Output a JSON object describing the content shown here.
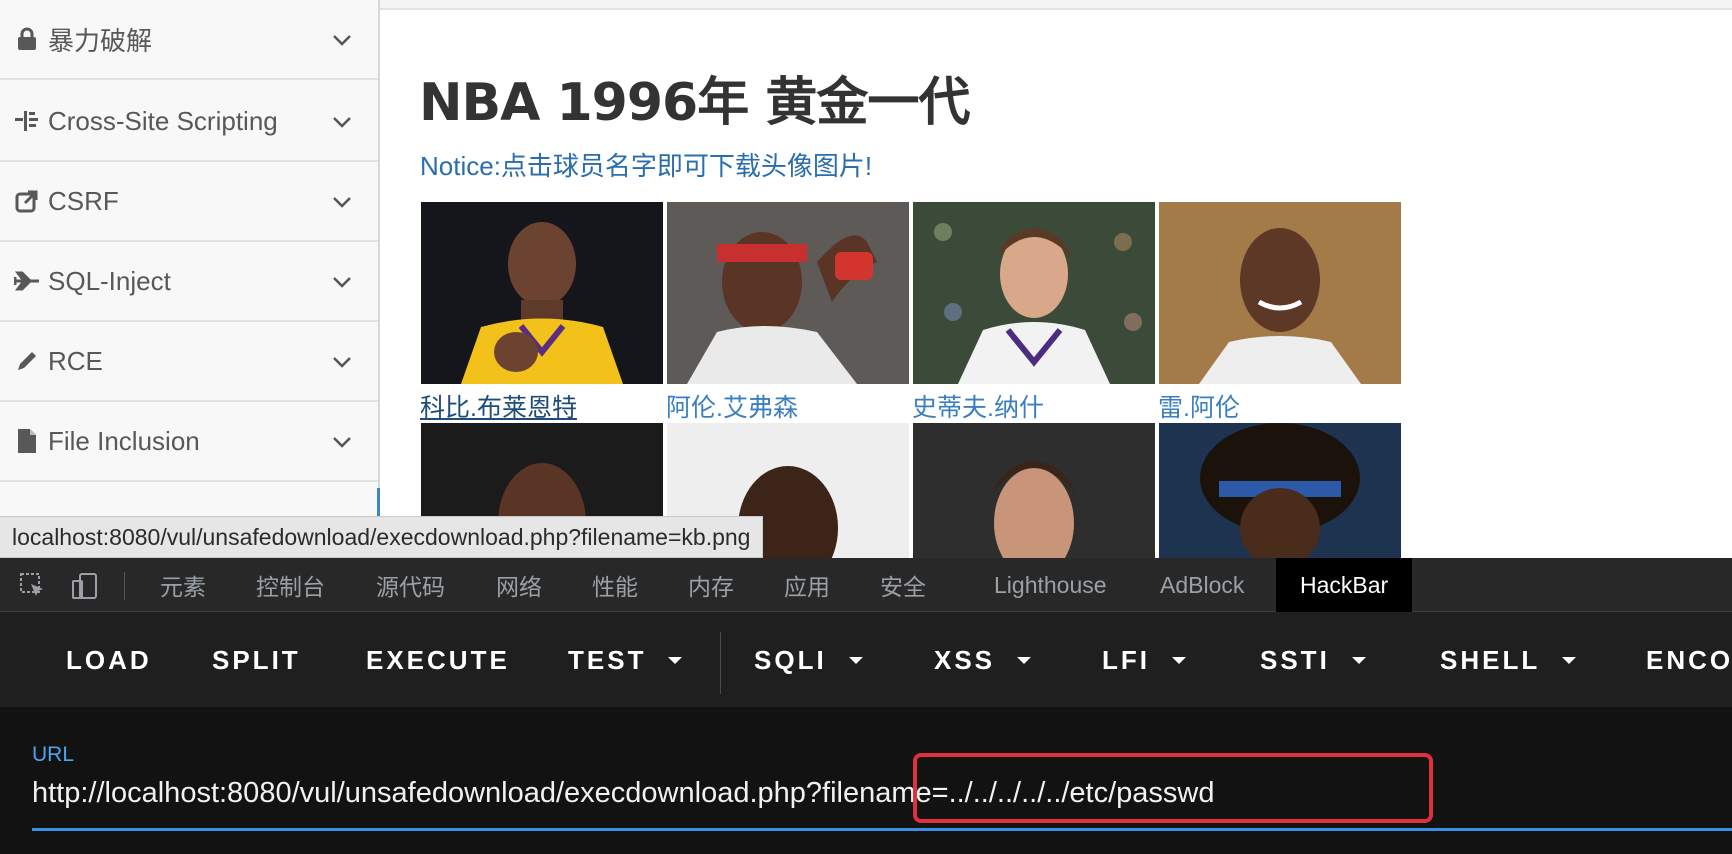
{
  "sidebar": {
    "items": [
      {
        "label": "暴力破解",
        "icon": "lock-icon"
      },
      {
        "label": "Cross-Site Scripting",
        "icon": "indent-icon"
      },
      {
        "label": "CSRF",
        "icon": "share-icon"
      },
      {
        "label": "SQL-Inject",
        "icon": "plane-icon"
      },
      {
        "label": "RCE",
        "icon": "pencil-icon"
      },
      {
        "label": "File Inclusion",
        "icon": "file-icon"
      }
    ]
  },
  "main": {
    "title": "NBA 1996年 黄金一代",
    "notice": "Notice:点击球员名字即可下载头像图片!",
    "players": [
      {
        "name": "科比.布莱恩特"
      },
      {
        "name": "阿伦.艾弗森"
      },
      {
        "name": "史蒂夫.纳什"
      },
      {
        "name": "雷.阿伦"
      }
    ]
  },
  "status_url": "localhost:8080/vul/unsafedownload/execdownload.php?filename=kb.png",
  "devtools": {
    "tabs": [
      "元素",
      "控制台",
      "源代码",
      "网络",
      "性能",
      "内存",
      "应用",
      "安全",
      "Lighthouse",
      "AdBlock",
      "HackBar"
    ],
    "selected_tab": "HackBar"
  },
  "hackbar": {
    "buttons": [
      {
        "label": "LOAD"
      },
      {
        "label": "SPLIT"
      },
      {
        "label": "EXECUTE"
      },
      {
        "label": "TEST"
      },
      {
        "label": "SQLI"
      },
      {
        "label": "XSS"
      },
      {
        "label": "LFI"
      },
      {
        "label": "SSTI"
      },
      {
        "label": "SHELL"
      },
      {
        "label": "ENCODING"
      }
    ],
    "url_label": "URL",
    "url_value": "http://localhost:8080/vul/unsafedownload/execdownload.php?filename=../../../../../etc/passwd"
  },
  "colors": {
    "link": "#3b7fc0",
    "hackbar_bg": "#121212",
    "highlight": "#e0303e",
    "url_underline": "#3b8ee6"
  }
}
